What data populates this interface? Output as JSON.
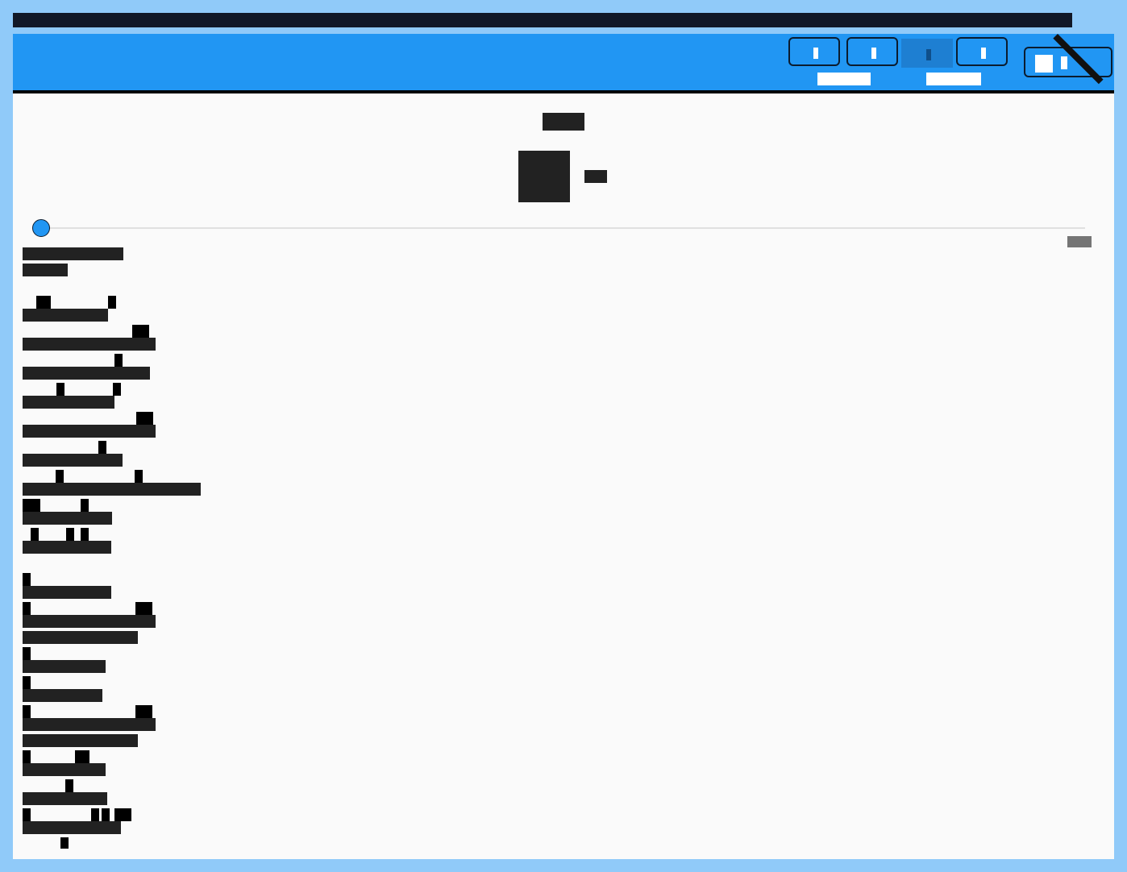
{
  "window": {
    "app_title": "",
    "page_title": ""
  },
  "header": {
    "nav": [
      {
        "name": "nav-item-1",
        "label": ""
      },
      {
        "name": "nav-item-2",
        "label": ""
      },
      {
        "name": "nav-item-3",
        "label": ""
      },
      {
        "name": "nav-item-4",
        "label": ""
      }
    ],
    "exit": {
      "label": ""
    }
  },
  "main": {
    "widget_label": "",
    "slider_value_text": "",
    "log_lines": [
      "",
      "",
      "",
      "",
      "",
      "",
      "",
      "",
      "",
      "",
      "",
      "",
      "",
      "",
      "",
      "",
      "",
      "",
      "",
      ""
    ]
  },
  "colors": {
    "accent": "#2196f3",
    "background": "#fafafa",
    "frame": "#90caf9",
    "text_dark": "#222222"
  }
}
